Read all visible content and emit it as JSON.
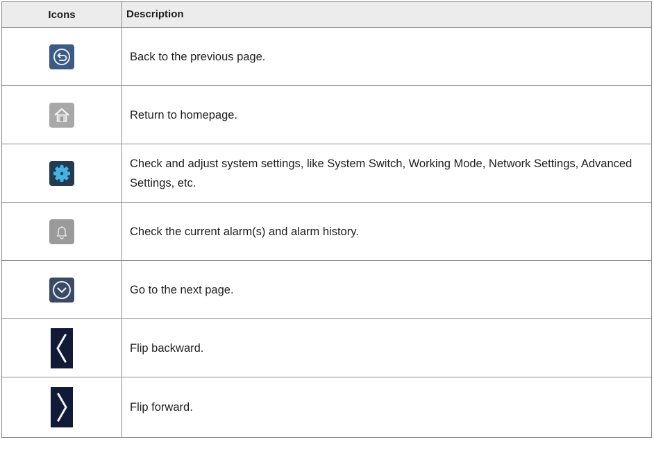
{
  "header": {
    "icons_label": "Icons",
    "description_label": "Description"
  },
  "rows": [
    {
      "icon": "back-icon",
      "description": "Back to the previous page."
    },
    {
      "icon": "home-icon",
      "description": "Return to homepage."
    },
    {
      "icon": "gear-icon",
      "description": "Check and adjust system settings, like System Switch, Working Mode, Network Settings, Advanced Settings, etc."
    },
    {
      "icon": "bell-icon",
      "description": "Check the current alarm(s) and alarm history."
    },
    {
      "icon": "chevron-down-icon",
      "description": "Go to the next page."
    },
    {
      "icon": "chevron-left-icon",
      "description": "Flip backward."
    },
    {
      "icon": "chevron-right-icon",
      "description": "Flip forward."
    }
  ]
}
